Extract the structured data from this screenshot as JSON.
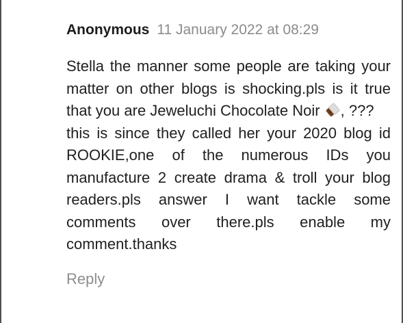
{
  "comment": {
    "author": "Anonymous",
    "timestamp": "11 January 2022 at 08:29",
    "body_part1": "Stella the manner some people are taking your matter on other blogs is shocking.pls is it true that you are Jeweluchi Chocolate Noir ",
    "emoji_icon": "chocolate-bar-icon",
    "body_part2": ", ???",
    "body_part3": "this is since they called her your 2020 blog id ROOKIE,one of the numerous IDs you manufacture 2 create drama & troll your blog readers.pls answer I want tackle some comments over there.pls enable my comment.thanks",
    "reply_label": "Reply"
  },
  "colors": {
    "author": "#1d1d1d",
    "timestamp": "#8b8b8b",
    "body_text": "#202020",
    "reply": "#8d8d8d",
    "frame_border": "#505050"
  }
}
